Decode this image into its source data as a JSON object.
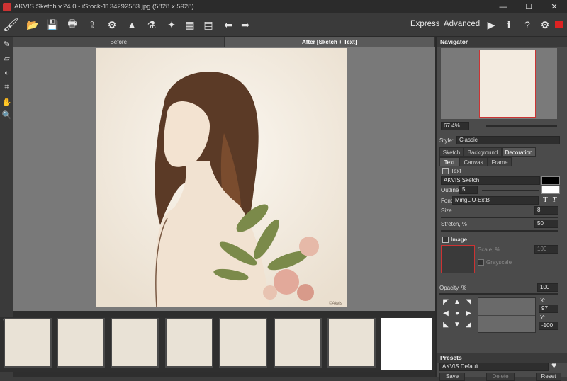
{
  "window": {
    "title": "AKVIS Sketch v.24.0 - iStock-1134292583.jpg (5828 x 5928)",
    "minimize": "—",
    "maximize": "☐",
    "close": "✕"
  },
  "toolbar": {
    "express_label": "Express",
    "advanced_label": "Advanced"
  },
  "view_tabs": {
    "before": "Before",
    "after": "After [Sketch + Text]"
  },
  "watermark": "©Akvis",
  "navigator": {
    "header": "Navigator",
    "zoom": "67.4%"
  },
  "settings": {
    "style_label": "Style:",
    "style_value": "Classic",
    "tabs": [
      "Sketch",
      "Background",
      "Decoration"
    ],
    "active_tab": "Decoration",
    "subtabs": [
      "Text",
      "Canvas",
      "Frame"
    ],
    "text_checkbox": "Text",
    "text_value": "AKVIS Sketch",
    "outline_label": "Outline",
    "outline_value": "5",
    "font_label": "Font",
    "font_value": "MingLiU-ExtB",
    "size_label": "Size",
    "size_value": "8",
    "stretch_label": "Stretch, %",
    "stretch_value": "50",
    "image_checkbox": "Image",
    "scale_label": "Scale, %",
    "scale_value": "100",
    "grayscale_label": "Grayscale",
    "opacity_label": "Opacity, %",
    "opacity_value": "100",
    "x_label": "X:",
    "x_value": "97",
    "y_label": "Y:",
    "y_value": "-100",
    "colors": {
      "text_color": "#000000",
      "outline_color": "#ffffff"
    }
  },
  "presets": {
    "header": "Presets",
    "value": "AKVIS Default",
    "save": "Save",
    "delete": "Delete",
    "reset": "Reset"
  }
}
